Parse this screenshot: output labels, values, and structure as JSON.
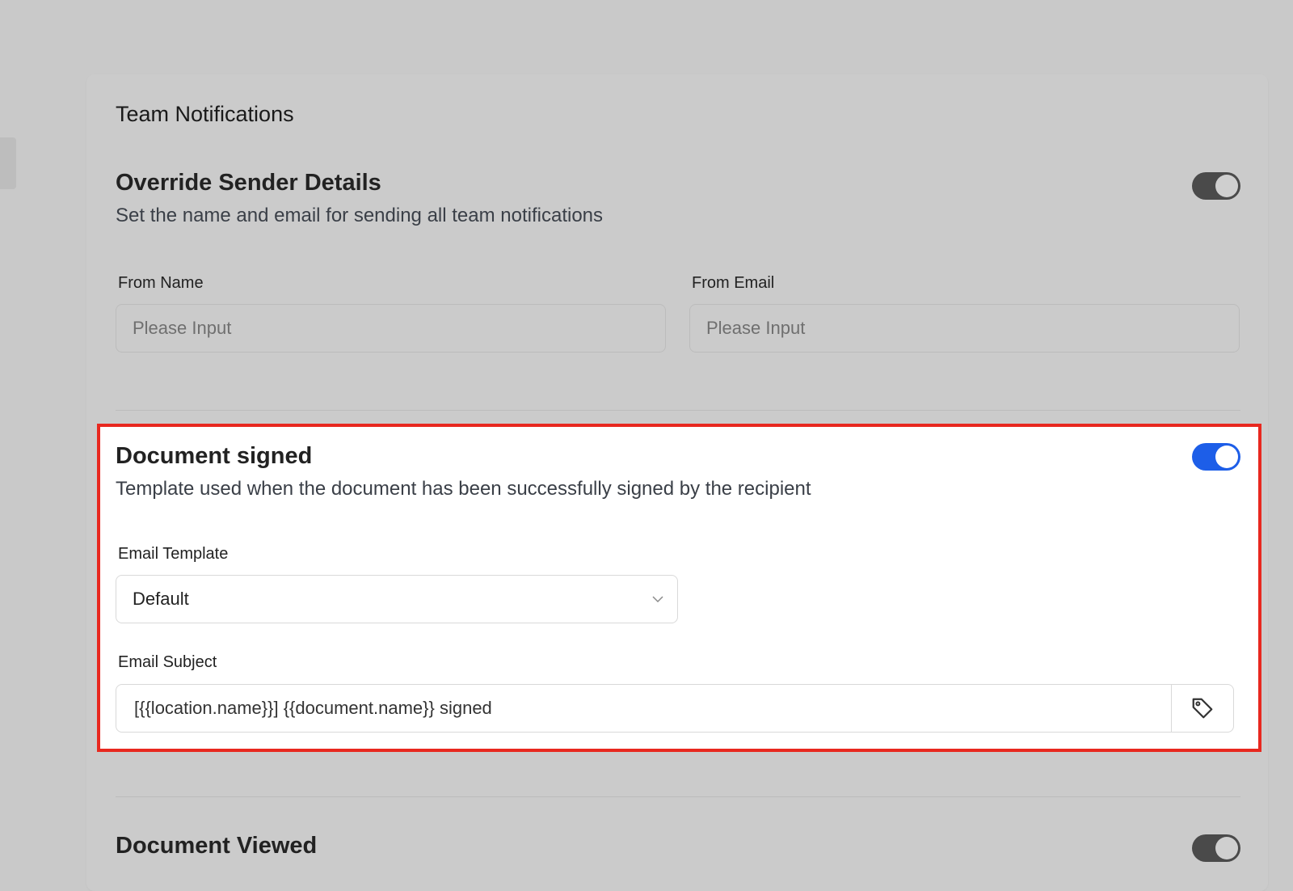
{
  "card": {
    "title": "Team Notifications"
  },
  "override_sender": {
    "title": "Override Sender Details",
    "description": "Set the name and email for sending all team notifications",
    "enabled": false,
    "from_name": {
      "label": "From Name",
      "placeholder": "Please Input"
    },
    "from_email": {
      "label": "From Email",
      "placeholder": "Please Input"
    }
  },
  "document_signed": {
    "title": "Document signed",
    "description": "Template used when the document has been successfully signed by the recipient",
    "enabled": true,
    "email_template": {
      "label": "Email Template",
      "value": "Default"
    },
    "email_subject": {
      "label": "Email Subject",
      "value": "[{{location.name}}] {{document.name}} signed"
    }
  },
  "document_viewed": {
    "title": "Document Viewed",
    "enabled": false
  },
  "colors": {
    "toggle_on": "#1d5ee8",
    "toggle_off": "#4a4a4a",
    "highlight_border": "#e8281f"
  },
  "icons": {
    "select_chevron": "chevron-down-icon",
    "tag_button": "tag-icon"
  }
}
